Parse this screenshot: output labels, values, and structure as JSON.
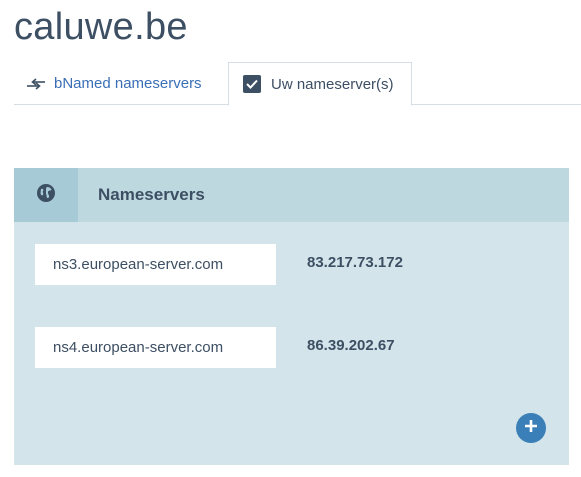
{
  "header": {
    "domain": "caluwe.be"
  },
  "tabs": [
    {
      "label": "bNamed nameservers",
      "icon": "swap-arrows-icon",
      "active": false
    },
    {
      "label": "Uw nameserver(s)",
      "icon": "checkbox-checked-icon",
      "active": true
    }
  ],
  "panel": {
    "title": "Nameservers",
    "icon": "globe-icon",
    "rows": [
      {
        "hostname": "ns3.european-server.com",
        "ip": "83.217.73.172"
      },
      {
        "hostname": "ns4.european-server.com",
        "ip": "86.39.202.67"
      }
    ],
    "add_icon": "plus-circle-icon"
  },
  "colors": {
    "accent": "#3a7fb8",
    "link": "#3a6fb6",
    "panel_bg": "#d3e5ea",
    "panel_header_bg": "#bed8e0",
    "panel_icon_bg": "#a7cbd6",
    "text": "#3d4f63"
  }
}
